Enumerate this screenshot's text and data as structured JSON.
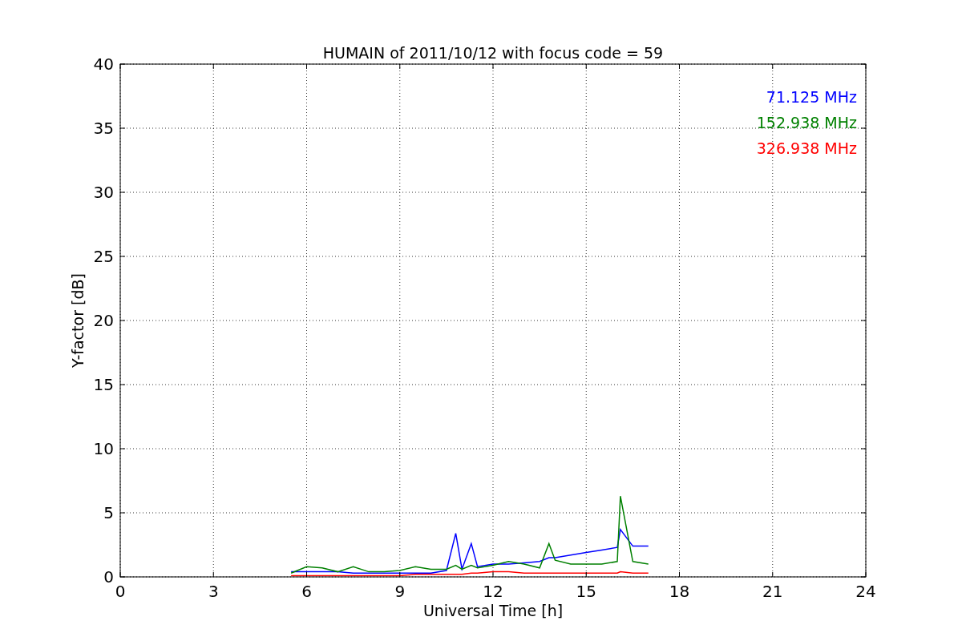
{
  "chart_data": {
    "type": "line",
    "title": "HUMAIN of 2011/10/12 with focus code = 59",
    "xlabel": "Universal Time [h]",
    "ylabel": "Y-factor [dB]",
    "x": [
      5.5,
      6,
      6.5,
      7,
      7.5,
      8,
      8.5,
      9,
      9.5,
      10,
      10.5,
      10.8,
      11,
      11.3,
      11.5,
      12,
      12.5,
      13,
      13.5,
      13.8,
      14,
      14.5,
      15,
      15.5,
      16,
      16.1,
      16.5,
      17
    ],
    "series": [
      {
        "name": "71.125 MHz",
        "color": "#0000ff",
        "values": [
          0.4,
          0.4,
          0.4,
          0.4,
          0.3,
          0.3,
          0.3,
          0.3,
          0.3,
          0.3,
          0.5,
          3.4,
          0.6,
          2.6,
          0.8,
          1.0,
          1.0,
          1.1,
          1.2,
          1.5,
          1.5,
          1.7,
          1.9,
          2.1,
          2.3,
          3.7,
          2.4,
          2.4
        ]
      },
      {
        "name": "152.938 MHz",
        "color": "#008000",
        "values": [
          0.3,
          0.8,
          0.7,
          0.4,
          0.8,
          0.4,
          0.4,
          0.5,
          0.8,
          0.6,
          0.6,
          0.9,
          0.6,
          0.9,
          0.7,
          0.9,
          1.2,
          1.0,
          0.7,
          2.6,
          1.3,
          1.0,
          1.0,
          1.0,
          1.2,
          6.3,
          1.2,
          1.0
        ]
      },
      {
        "name": "326.938 MHz",
        "color": "#ff0000",
        "values": [
          0.1,
          0.1,
          0.1,
          0.1,
          0.1,
          0.1,
          0.1,
          0.1,
          0.2,
          0.2,
          0.2,
          0.2,
          0.2,
          0.3,
          0.3,
          0.4,
          0.4,
          0.3,
          0.3,
          0.3,
          0.3,
          0.3,
          0.3,
          0.3,
          0.3,
          0.4,
          0.3,
          0.3
        ]
      }
    ],
    "xlim": [
      0,
      24
    ],
    "ylim": [
      0,
      40
    ],
    "xticks": [
      0,
      3,
      6,
      9,
      12,
      15,
      18,
      21,
      24
    ],
    "yticks": [
      0,
      5,
      10,
      15,
      20,
      25,
      30,
      35,
      40
    ],
    "grid": true
  }
}
